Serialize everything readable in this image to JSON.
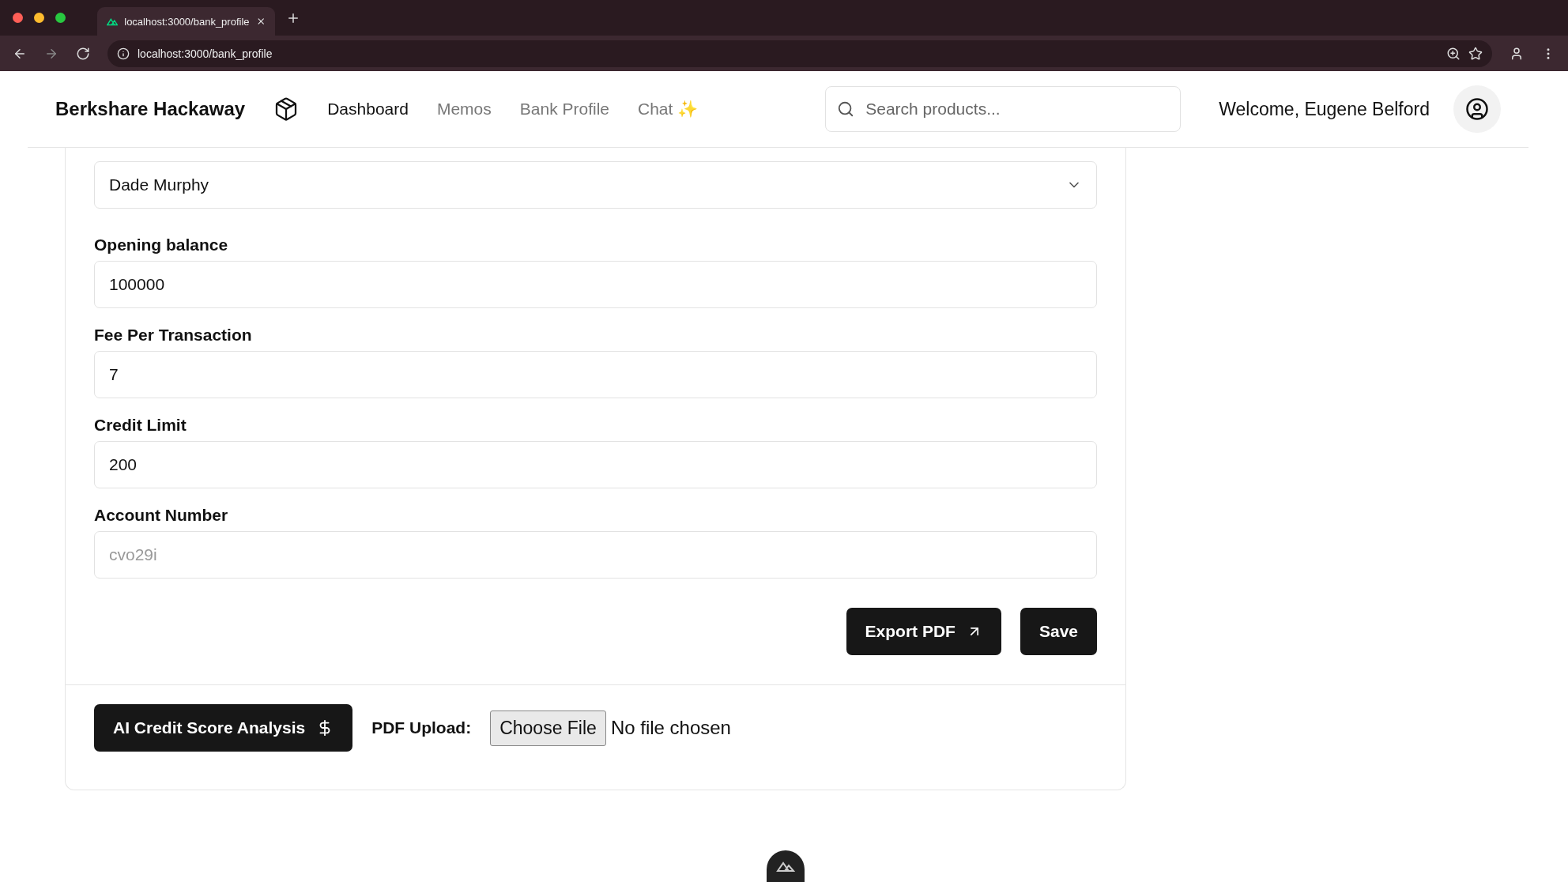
{
  "browser": {
    "tab_title": "localhost:3000/bank_profile",
    "url": "localhost:3000/bank_profile"
  },
  "header": {
    "brand": "Berkshare Hackaway",
    "nav": [
      {
        "label": "Dashboard",
        "selected": true
      },
      {
        "label": "Memos",
        "selected": false
      },
      {
        "label": "Bank Profile",
        "selected": false
      },
      {
        "label": "Chat ✨",
        "selected": false
      }
    ],
    "search": {
      "placeholder": "Search products..."
    },
    "welcome": "Welcome, Eugene Belford"
  },
  "form": {
    "customer_select": {
      "value": "Dade Murphy"
    },
    "fields": [
      {
        "label": "Opening balance",
        "value": "100000",
        "disabled": false
      },
      {
        "label": "Fee Per Transaction",
        "value": "7",
        "disabled": false
      },
      {
        "label": "Credit Limit",
        "value": "200",
        "disabled": false
      },
      {
        "label": "Account Number",
        "value": "cvo29i",
        "disabled": true
      }
    ],
    "actions": [
      "Export PDF",
      "Save"
    ]
  },
  "analysis": {
    "button": "AI Credit Score Analysis",
    "upload_label": "PDF Upload:",
    "choose_file": "Choose File",
    "file_status": "No file chosen"
  }
}
